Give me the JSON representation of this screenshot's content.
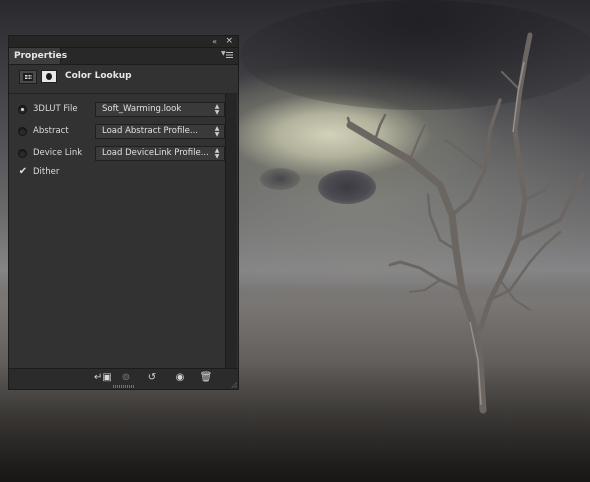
{
  "panel": {
    "tab_label": "Properties",
    "collapse_glyph": "«",
    "close_glyph": "×",
    "menu_icon": "panel-menu-icon"
  },
  "adjustment": {
    "icon": "adjustment-grid-icon",
    "mask_icon": "layer-mask-icon",
    "title": "Color Lookup"
  },
  "options": [
    {
      "label": "3DLUT File",
      "value": "Soft_Warming.look",
      "selected": true
    },
    {
      "label": "Abstract",
      "value": "Load Abstract Profile...",
      "selected": false
    },
    {
      "label": "Device Link",
      "value": "Load DeviceLink Profile...",
      "selected": false
    }
  ],
  "dither": {
    "label": "Dither",
    "checked": true,
    "glyph": "✔"
  },
  "footer": {
    "clip_icon": "clip-to-layer-icon",
    "view_previous_icon": "view-previous-state-icon",
    "reset_icon": "reset-icon",
    "visibility_icon": "eye-icon",
    "delete_icon": "trash-icon"
  },
  "colors": {
    "panel_bg": "#323232",
    "title_bar": "#262626",
    "text": "#dcdcdc"
  }
}
